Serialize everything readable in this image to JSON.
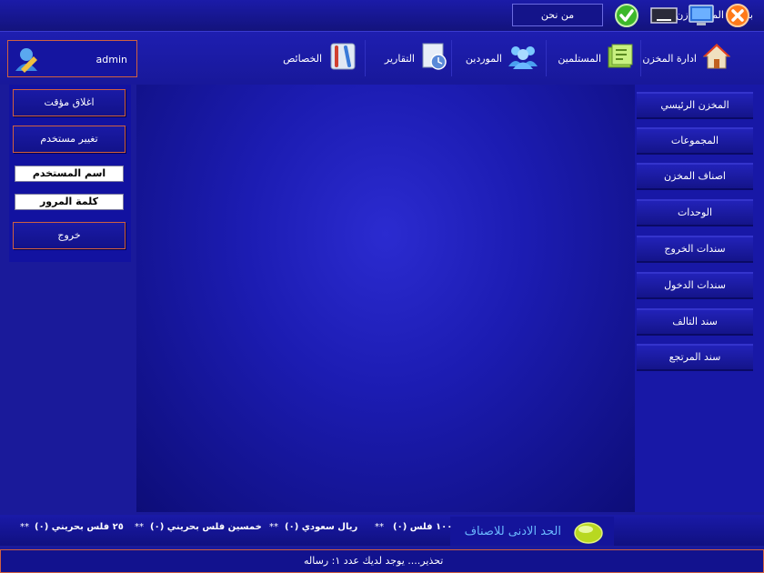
{
  "window": {
    "title": "برنامج المخـــــازن"
  },
  "header": {
    "about_label": "من نحن"
  },
  "user": {
    "name": "admin"
  },
  "nav": [
    {
      "label": "ادارة المخزن",
      "icon": "home-icon"
    },
    {
      "label": "المستلمين",
      "icon": "folder-icon"
    },
    {
      "label": "الموردين",
      "icon": "users-icon"
    },
    {
      "label": "التقارير",
      "icon": "clock-icon"
    },
    {
      "label": "الخصائص",
      "icon": "tools-icon"
    }
  ],
  "left_panel": {
    "close_label": "اغلاق مؤقت",
    "change_user_label": "تغيير مستخدم",
    "username_label": "اسم المستخدم",
    "password_label": "كلمة المرور",
    "exit_label": "خروج"
  },
  "sidebar": [
    "المخزن الرئيسي",
    "المجموعات",
    "اصناف المخزن",
    "الوحدات",
    "سندات الخروج",
    "سندات الدخول",
    "سند التالف",
    "سند المرتجع"
  ],
  "ticker": {
    "title": "الحد الادنى للاصناف",
    "items": [
      "١٠٠ فلس (٠)",
      "ريال سعودي (٠)",
      "خمسين فلس بحريني (٠)",
      "٢٥ فلس بحريني (٠)"
    ],
    "separator": "**"
  },
  "status": {
    "message": "تحذير.... يوجد لديك عدد   ١:  رساله"
  },
  "colors": {
    "background": "#1a1a9a",
    "accent_border": "#d06040",
    "ticker_label": "#6ab8ff"
  }
}
